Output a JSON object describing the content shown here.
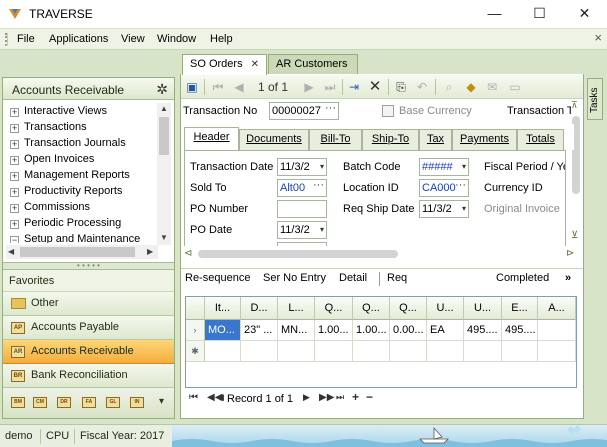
{
  "window": {
    "title": "TRAVERSE"
  },
  "menu": [
    "File",
    "Applications",
    "View",
    "Window",
    "Help"
  ],
  "nav": {
    "title": "Accounts Receivable",
    "tree": [
      "Interactive Views",
      "Transactions",
      "Transaction Journals",
      "Open Invoices",
      "Management Reports",
      "Productivity Reports",
      "Commissions",
      "Periodic Processing",
      "Setup and Maintenance"
    ],
    "tree_signs": [
      "+",
      "+",
      "+",
      "+",
      "+",
      "+",
      "+",
      "+",
      "−"
    ]
  },
  "favorites": {
    "title": "Favorites",
    "items": [
      "Other",
      "Accounts Payable",
      "Accounts Receivable",
      "Bank Reconciliation"
    ],
    "icon_codes": [
      "",
      "AP",
      "AR",
      "BR"
    ],
    "active": "Accounts Receivable",
    "mini_icons": [
      "BM",
      "CM",
      "DR",
      "FA",
      "GL",
      "IN"
    ]
  },
  "tabs": {
    "active": "SO Orders",
    "inactive": "AR Customers"
  },
  "toolbar": {
    "page": "1 of 1"
  },
  "header": {
    "transaction_no_label": "Transaction No",
    "transaction_no": "00000027",
    "base_currency_label": "Base Currency",
    "transaction_type_label": "Transaction T"
  },
  "subtabs": [
    "Header",
    "Documents",
    "Bill-To",
    "Ship-To",
    "Tax",
    "Payments",
    "Totals"
  ],
  "form": {
    "transaction_date_label": "Transaction Date",
    "transaction_date": "11/3/2",
    "sold_to_label": "Sold To",
    "sold_to": "Alt00",
    "po_number_label": "PO Number",
    "po_number": "",
    "po_date_label": "PO Date",
    "po_date": "11/3/2",
    "batch_code_label": "Batch Code",
    "batch_code": "#####",
    "location_id_label": "Location ID",
    "location_id": "CA000",
    "req_ship_date_label": "Req Ship Date",
    "req_ship_date": "11/3/2",
    "fiscal_period_label": "Fiscal Period / Ye",
    "currency_id_label": "Currency ID",
    "original_invoice_label": "Original Invoice"
  },
  "actions": [
    "Re-sequence",
    "Ser No Entry",
    "Detail",
    "Req"
  ],
  "completed": "Completed",
  "grid": {
    "headers": [
      "It...",
      "D...",
      "L...",
      "Q...",
      "Q...",
      "Q...",
      "U...",
      "U...",
      "E...",
      "A..."
    ],
    "row": [
      "MO...",
      "23\" ...",
      "MN...",
      "1.00...",
      "1.00...",
      "0.00...",
      "EA",
      "495....",
      "495....",
      ""
    ]
  },
  "record_nav": {
    "label": "Record 1 of 1"
  },
  "tasks_label": "Tasks",
  "status": {
    "company": "demo",
    "user": "CPU",
    "fiscal_year": "Fiscal Year: 2017"
  }
}
